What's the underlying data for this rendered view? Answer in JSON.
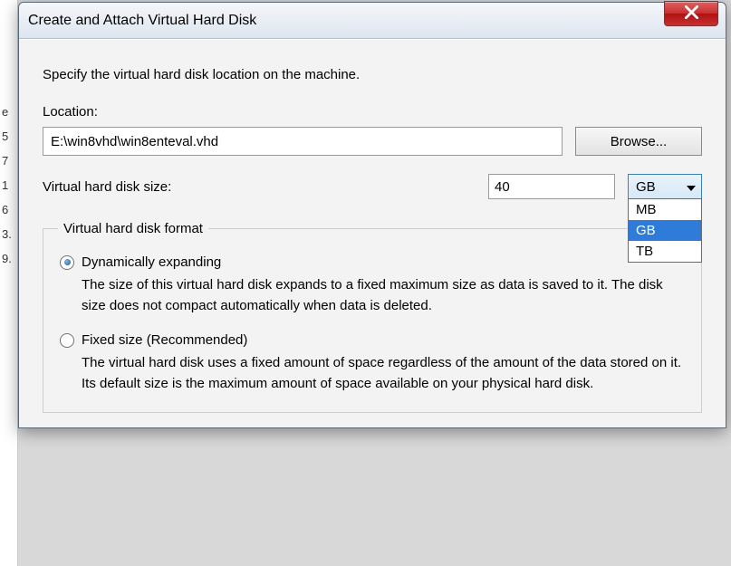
{
  "window": {
    "title": "Create and Attach Virtual Hard Disk"
  },
  "instruction": "Specify the virtual hard disk location on the machine.",
  "location": {
    "label": "Location:",
    "value": "E:\\win8vhd\\win8enteval.vhd",
    "browse": "Browse..."
  },
  "size": {
    "label": "Virtual hard disk size:",
    "value": "40",
    "unit_selected": "GB",
    "unit_options": [
      "MB",
      "GB",
      "TB"
    ]
  },
  "format": {
    "legend": "Virtual hard disk format",
    "option1": {
      "label": "Dynamically expanding",
      "checked": true,
      "description": "The size of this virtual hard disk expands to a fixed maximum size as data is saved to it.  The disk size does not compact automatically when data is deleted."
    },
    "option2": {
      "label": "Fixed size (Recommended)",
      "checked": false,
      "description": "The virtual hard disk uses a fixed amount of space regardless of the amount of the data stored on it.  Its default size is the maximum amount of space available on your physical hard disk."
    }
  },
  "bg_numbers": [
    "e",
    "5",
    "7",
    "1",
    "6",
    "3.",
    "9."
  ]
}
